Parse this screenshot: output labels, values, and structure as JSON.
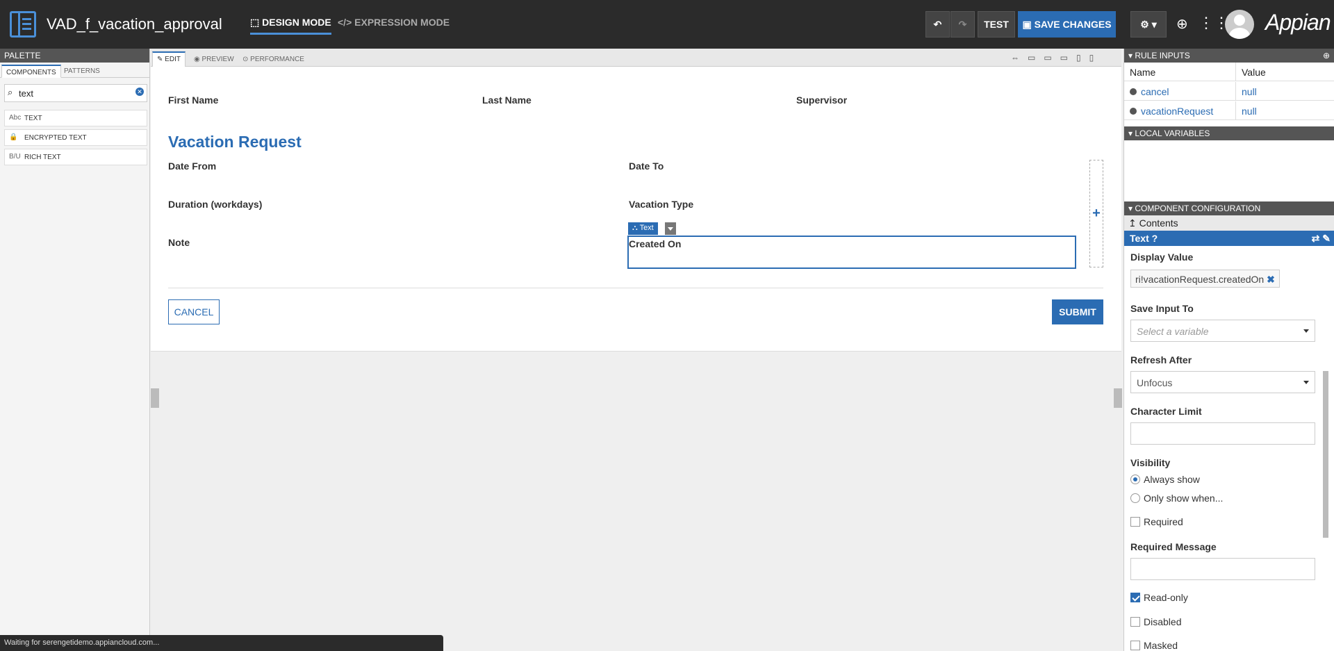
{
  "header": {
    "title": "VAD_f_vacation_approval",
    "design_mode": "DESIGN MODE",
    "expression_mode": "EXPRESSION MODE",
    "test": "TEST",
    "save": "SAVE CHANGES",
    "brand": "Appian"
  },
  "palette": {
    "title": "PALETTE",
    "tabs": [
      "COMPONENTS",
      "PATTERNS"
    ],
    "search_value": "text",
    "items": [
      {
        "icon": "Abc",
        "label": "TEXT"
      },
      {
        "icon": "lock",
        "label": "ENCRYPTED TEXT"
      },
      {
        "icon": "B/U",
        "label": "RICH TEXT"
      }
    ]
  },
  "editor": {
    "tabs": [
      "EDIT",
      "PREVIEW",
      "PERFORMANCE"
    ],
    "fields": {
      "first_name": "First Name",
      "last_name": "Last Name",
      "supervisor": "Supervisor",
      "section_title": "Vacation Request",
      "date_from": "Date From",
      "date_to": "Date To",
      "duration": "Duration (workdays)",
      "vacation_type": "Vacation Type",
      "note": "Note",
      "created_on": "Created On"
    },
    "selected_tag": "Text",
    "cancel": "CANCEL",
    "submit": "SUBMIT"
  },
  "status": "Waiting for serengetidemo.appiancloud.com...",
  "right": {
    "rule_inputs_title": "RULE INPUTS",
    "col_name": "Name",
    "col_value": "Value",
    "inputs": [
      {
        "name": "cancel",
        "value": "null"
      },
      {
        "name": "vacationRequest",
        "value": "null"
      }
    ],
    "local_vars_title": "LOCAL VARIABLES",
    "config_title": "COMPONENT CONFIGURATION",
    "contents": "Contents",
    "component": "Text",
    "display_value_label": "Display Value",
    "display_value": "ri!vacationRequest.createdOn",
    "save_input_label": "Save Input To",
    "save_input_placeholder": "Select a variable",
    "refresh_label": "Refresh After",
    "refresh_value": "Unfocus",
    "char_limit_label": "Character Limit",
    "visibility_label": "Visibility",
    "always_show": "Always show",
    "only_show": "Only show when...",
    "required": "Required",
    "required_msg_label": "Required Message",
    "read_only": "Read-only",
    "disabled": "Disabled",
    "masked": "Masked"
  },
  "colors": {
    "accent": "#2b6cb3",
    "topbar": "#2b2b2b"
  }
}
